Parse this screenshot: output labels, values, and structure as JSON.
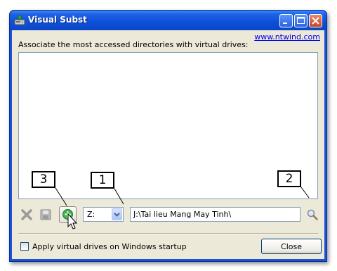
{
  "window": {
    "title": "Visual Subst",
    "minimize_icon": "minimize-icon",
    "maximize_icon": "maximize-icon",
    "close_icon": "close-icon"
  },
  "header": {
    "link": "www.ntwind.com",
    "description": "Associate the most accessed directories with virtual drives:"
  },
  "toolbar": {
    "delete_icon": "delete-x-icon",
    "save_icon": "floppy-disk-icon",
    "add_icon": "add-plus-icon",
    "drive_select": {
      "value": "Z:"
    },
    "path_input": {
      "value": "J:\\Tai lieu Mang May Tinh\\"
    },
    "browse_icon": "magnifier-icon"
  },
  "footer": {
    "startup_checkbox_label": "Apply virtual drives on Windows startup",
    "startup_checked": false,
    "close_label": "Close"
  },
  "callouts": [
    "1",
    "2",
    "3"
  ],
  "colors": {
    "titlebar": "#0d4fd8",
    "client": "#ece9d8",
    "link": "#0000ee"
  }
}
